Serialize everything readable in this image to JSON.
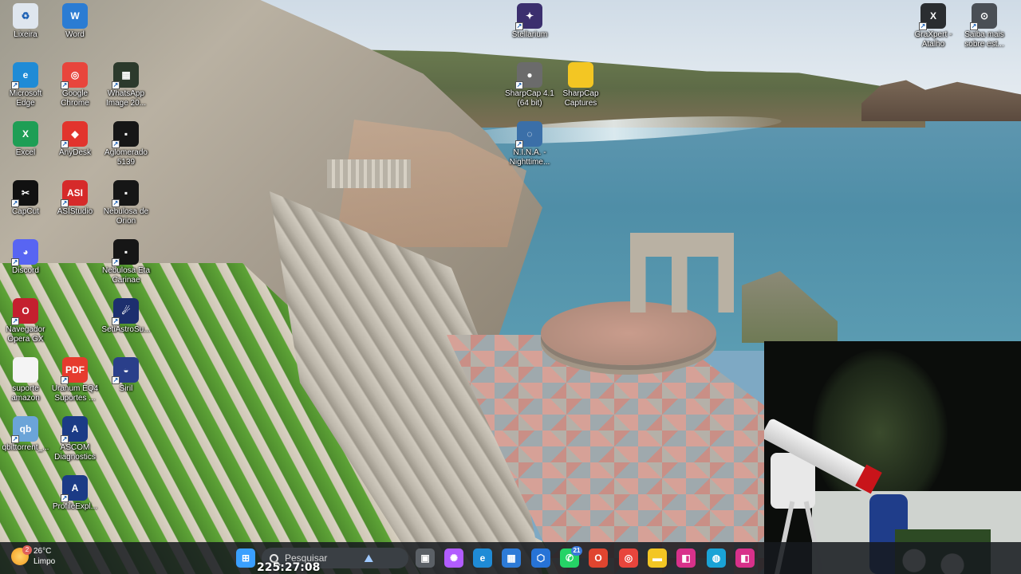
{
  "desktop_icons": [
    {
      "name": "recycle-bin-icon",
      "label": "Lixeira",
      "color": "#dfe6ee",
      "glyph": "♻"
    },
    {
      "name": "word-icon",
      "label": "Word",
      "color": "#2b7cd3",
      "glyph": "W"
    },
    {
      "name": "stellarium-icon",
      "label": "Stellarium",
      "color": "#3b2f6e",
      "glyph": "✦"
    },
    {
      "name": "graxpert-icon",
      "label": "GraXpert -\nAtalho",
      "color": "#2a2d30",
      "glyph": "X"
    },
    {
      "name": "saiba-mais-icon",
      "label": "Saiba mais\nsobre est...",
      "color": "#4a4f55",
      "glyph": "⊙"
    },
    {
      "name": "edge-icon",
      "label": "Microsoft\nEdge",
      "color": "#1f8bd6",
      "glyph": "e"
    },
    {
      "name": "chrome-icon",
      "label": "Google\nChrome",
      "color": "#e8453c",
      "glyph": "◎"
    },
    {
      "name": "whatsapp-image-icon",
      "label": "WhatsApp\nImage 20...",
      "color": "#2c3a2c",
      "glyph": "▦"
    },
    {
      "name": "sharpcap-icon",
      "label": "SharpCap 4.1\n(64 bit)",
      "color": "#6b6b6b",
      "glyph": "●"
    },
    {
      "name": "sharpcap-captures-folder-icon",
      "label": "SharpCap\nCaptures",
      "color": "#f3c623",
      "glyph": ""
    },
    {
      "name": "excel-icon",
      "label": "Excel",
      "color": "#1e9e55",
      "glyph": "X"
    },
    {
      "name": "anydesk-icon",
      "label": "AnyDesk",
      "color": "#e2342d",
      "glyph": "◆"
    },
    {
      "name": "aglomerado-icon",
      "label": "Aglomerado\n5139",
      "color": "#161616",
      "glyph": "▪"
    },
    {
      "name": "nina-icon",
      "label": "N.I.N.A. -\nNighttime...",
      "color": "#3b6fa8",
      "glyph": "◌"
    },
    {
      "name": "capcut-icon",
      "label": "CapCut",
      "color": "#111111",
      "glyph": "✂"
    },
    {
      "name": "asistudio-icon",
      "label": "ASIStudio",
      "color": "#d62a2a",
      "glyph": "ASI"
    },
    {
      "name": "nebulosa-orion-icon",
      "label": "Nebulosa de\nOrion",
      "color": "#161616",
      "glyph": "▪"
    },
    {
      "name": "discord-icon",
      "label": "Discord",
      "color": "#5865f2",
      "glyph": "◕"
    },
    {
      "name": "nebulosa-eta-carinae-icon",
      "label": "Nebulosa Eta\nCarinae",
      "color": "#161616",
      "glyph": "▪"
    },
    {
      "name": "opera-gx-icon",
      "label": "Navegador\nOpera GX",
      "color": "#c4202f",
      "glyph": "O"
    },
    {
      "name": "setiastrosuite-icon",
      "label": "SetiAstroSu...",
      "color": "#1d2f6e",
      "glyph": "☄"
    },
    {
      "name": "suporte-amazon-file-icon",
      "label": "suporte\namazon",
      "color": "#f4f4f4",
      "glyph": ""
    },
    {
      "name": "uranum-pdf-icon",
      "label": "Uranum EQ4\nSuportes ...",
      "color": "#e63b2e",
      "glyph": "PDF"
    },
    {
      "name": "siril-icon",
      "label": "Siril",
      "color": "#2a3f8a",
      "glyph": "◒"
    },
    {
      "name": "qbittorrent-icon",
      "label": "qbittorrent_...",
      "color": "#6ba4d8",
      "glyph": "qb"
    },
    {
      "name": "ascom-diagnostics-icon",
      "label": "ASCOM\nDiagnostics",
      "color": "#1b3b86",
      "glyph": "A"
    },
    {
      "name": "profileexplorer-icon",
      "label": "ProfileExpl...",
      "color": "#1b3b86",
      "glyph": "A"
    }
  ],
  "taskbar": {
    "weather_temp": "26°C",
    "weather_cond": "Limpo",
    "weather_badge": "2",
    "search_placeholder": "Pesquisar",
    "whatsapp_badge": "21",
    "overlay_timer": "225:27:08",
    "apps": [
      {
        "name": "start-button",
        "color": "#3aa0ff",
        "glyph": "⊞"
      },
      {
        "name": "task-view-button",
        "color": "#5b6066",
        "glyph": "▣"
      },
      {
        "name": "copilot-button",
        "color": "#b25cff",
        "glyph": "✺"
      },
      {
        "name": "edge-taskbar-button",
        "color": "#1f8bd6",
        "glyph": "e"
      },
      {
        "name": "store-taskbar-button",
        "color": "#2d7bd8",
        "glyph": "▦"
      },
      {
        "name": "app-cube-taskbar-button",
        "color": "#2773d6",
        "glyph": "⬡"
      },
      {
        "name": "whatsapp-taskbar-button",
        "color": "#25d366",
        "glyph": "✆"
      },
      {
        "name": "opera-taskbar-button",
        "color": "#e0452f",
        "glyph": "O"
      },
      {
        "name": "chrome-taskbar-button",
        "color": "#e8453c",
        "glyph": "◎"
      },
      {
        "name": "explorer-taskbar-button",
        "color": "#f3c623",
        "glyph": "▬"
      },
      {
        "name": "app-pink-taskbar-button",
        "color": "#d8318a",
        "glyph": "◧"
      },
      {
        "name": "app-cyan-taskbar-button",
        "color": "#1aa3d6",
        "glyph": "◍"
      },
      {
        "name": "app-pink2-taskbar-button",
        "color": "#d8318a",
        "glyph": "◧"
      }
    ]
  }
}
